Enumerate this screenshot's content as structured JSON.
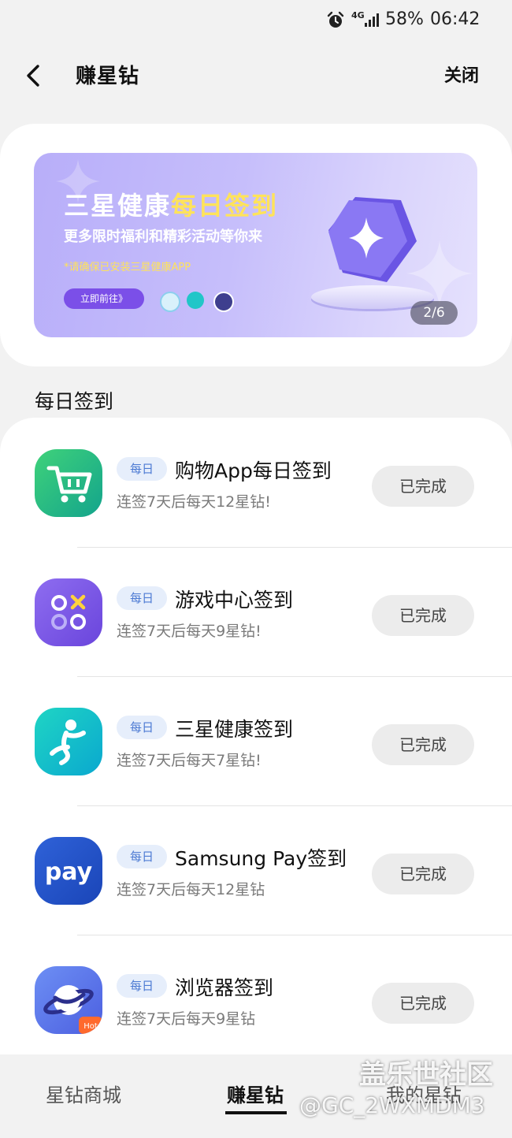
{
  "status_bar": {
    "network": "4G",
    "battery": "58%",
    "time": "06:42",
    "icons": [
      "alarm-icon",
      "signal-icon"
    ]
  },
  "header": {
    "title": "赚星钻",
    "close_label": "关闭",
    "back_icon": "chevron-left-icon"
  },
  "banner": {
    "title_prefix": "三星健康",
    "title_highlight": "每日签到",
    "subtitle": "更多限时福利和精彩活动等你来",
    "note": "*请确保已安装三星健康APP",
    "button_label": "立即前往》",
    "pager": "2/6",
    "highlight_color": "#ffe35a"
  },
  "section_title": "每日签到",
  "tasks": [
    {
      "icon": "shopping-cart-icon",
      "badge": "每日",
      "name": "购物App每日签到",
      "desc": "连签7天后每天12星钻!",
      "status": "已完成"
    },
    {
      "icon": "game-center-icon",
      "badge": "每日",
      "name": "游戏中心签到",
      "desc": "连签7天后每天9星钻!",
      "status": "已完成"
    },
    {
      "icon": "samsung-health-icon",
      "badge": "每日",
      "name": "三星健康签到",
      "desc": "连签7天后每天7星钻!",
      "status": "已完成"
    },
    {
      "icon": "samsung-pay-icon",
      "badge": "每日",
      "name": "Samsung Pay签到",
      "desc": "连签7天后每天12星钻",
      "status": "已完成",
      "icon_text": "pay"
    },
    {
      "icon": "browser-planet-icon",
      "badge": "每日",
      "name": "浏览器签到",
      "desc": "连签7天后每天9星钻",
      "status": "已完成",
      "icon_tag": "Hot"
    }
  ],
  "bottom_nav": {
    "tabs": [
      "星钻商城",
      "赚星钻",
      "我的星钻"
    ],
    "active": "赚星钻"
  },
  "watermark": {
    "line1": "盖乐世社区",
    "line2": "@GC_2WXMDM3"
  }
}
